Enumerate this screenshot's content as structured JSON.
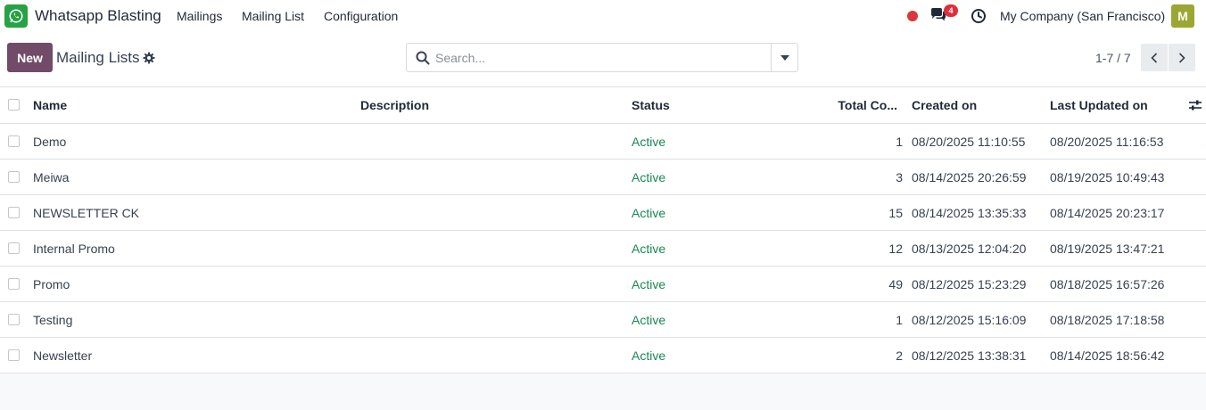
{
  "app": {
    "name": "Whatsapp Blasting",
    "icon": "whatsapp-icon"
  },
  "nav": {
    "menus": [
      "Mailings",
      "Mailing List",
      "Configuration"
    ]
  },
  "topbar": {
    "messages_badge": "4",
    "company": "My Company (San Francisco)",
    "avatar_letter": "M",
    "avatar_color": "#9ba733"
  },
  "control": {
    "new_label": "New",
    "breadcrumb": "Mailing Lists",
    "search_placeholder": "Search...",
    "pager": "1-7 / 7"
  },
  "table": {
    "columns": {
      "name": "Name",
      "description": "Description",
      "status": "Status",
      "total": "Total Co...",
      "created": "Created on",
      "updated": "Last Updated on"
    },
    "rows": [
      {
        "name": "Demo",
        "description": "",
        "status": "Active",
        "total": "1",
        "created": "08/20/2025 11:10:55",
        "updated": "08/20/2025 11:16:53"
      },
      {
        "name": "Meiwa",
        "description": "",
        "status": "Active",
        "total": "3",
        "created": "08/14/2025 20:26:59",
        "updated": "08/19/2025 10:49:43"
      },
      {
        "name": "NEWSLETTER CK",
        "description": "",
        "status": "Active",
        "total": "15",
        "created": "08/14/2025 13:35:33",
        "updated": "08/14/2025 20:23:17"
      },
      {
        "name": "Internal Promo",
        "description": "",
        "status": "Active",
        "total": "12",
        "created": "08/13/2025 12:04:20",
        "updated": "08/19/2025 13:47:21"
      },
      {
        "name": "Promo",
        "description": "",
        "status": "Active",
        "total": "49",
        "created": "08/12/2025 15:23:29",
        "updated": "08/18/2025 16:57:26"
      },
      {
        "name": "Testing",
        "description": "",
        "status": "Active",
        "total": "1",
        "created": "08/12/2025 15:16:09",
        "updated": "08/18/2025 17:18:58"
      },
      {
        "name": "Newsletter",
        "description": "",
        "status": "Active",
        "total": "2",
        "created": "08/12/2025 13:38:31",
        "updated": "08/14/2025 18:56:42"
      }
    ]
  },
  "colors": {
    "primary": "#714b67",
    "status_active": "#198754",
    "notification_red": "#e02d3c",
    "whatsapp_green": "#25a244"
  }
}
